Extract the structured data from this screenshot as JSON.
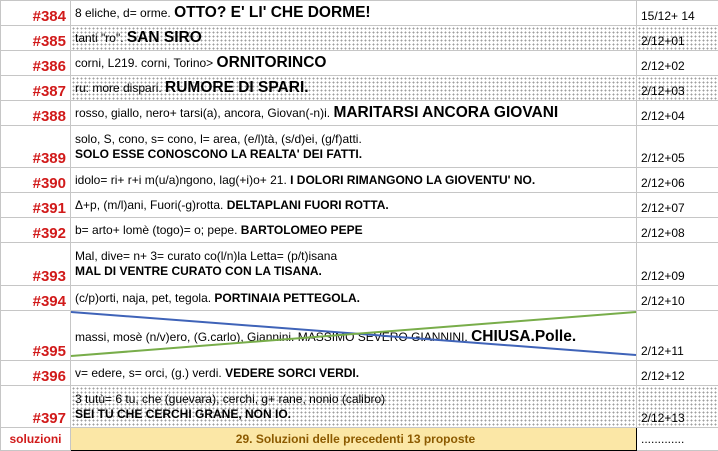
{
  "rows": [
    {
      "num": "#384",
      "parts": [
        {
          "t": "8 eliche, d= orme. "
        },
        {
          "t": "OTTO? E' LI' CHE DORME!",
          "c": "big"
        }
      ],
      "date": "15/12+ 14"
    },
    {
      "num": "#385",
      "parts": [
        {
          "t": "tanti \"ro\". "
        },
        {
          "t": "SAN SIRO",
          "c": "big"
        }
      ],
      "date": "2/12+01"
    },
    {
      "num": "#386",
      "parts": [
        {
          "t": "corni, L219. corni, Torino> "
        },
        {
          "t": "ORNITORINCO",
          "c": "big"
        }
      ],
      "date": "2/12+02"
    },
    {
      "num": "#387",
      "parts": [
        {
          "t": "ru: more dispari. "
        },
        {
          "t": "RUMORE DI SPARI.",
          "c": "big"
        }
      ],
      "date": "2/12+03"
    },
    {
      "num": "#388",
      "parts": [
        {
          "t": "rosso, giallo, nero+ tarsi(a), ancora, Giovan(-n)i. "
        },
        {
          "t": "MARITARSI ANCORA GIOVANI",
          "c": "big"
        }
      ],
      "date": "2/12+04"
    },
    {
      "num": "#389",
      "line1": "solo, S, cono, s= cono, l= area, (e/l)tà, (s/d)ei, (g/f)atti.",
      "line2": "SOLO ESSE CONOSCONO LA REALTA' DEI FATTI.",
      "date": "2/12+05"
    },
    {
      "num": "#390",
      "parts": [
        {
          "t": "idolo= ri+ r+i m(u/a)ngono, lag(+i)o+ 21. "
        },
        {
          "t": "I DOLORI RIMANGONO LA GIOVENTU' NO.",
          "c": "ans"
        }
      ],
      "date": "2/12+06"
    },
    {
      "num": "#391",
      "parts": [
        {
          "t": "Δ+p, (m/l)ani, Fuori(-g)rotta. "
        },
        {
          "t": "DELTAPLANI FUORI ROTTA.",
          "c": "ans"
        }
      ],
      "date": "2/12+07"
    },
    {
      "num": "#392",
      "parts": [
        {
          "t": "b= arto+ lomè (togo)= o; pepe. "
        },
        {
          "t": "BARTOLOMEO PEPE",
          "c": "ans"
        }
      ],
      "date": "2/12+08"
    },
    {
      "num": "#393",
      "line1": "Mal, dive= n+ 3= curato co(l/n)la Letta= (p/t)isana",
      "line2": "MAL DI VENTRE CURATO CON LA TISANA.",
      "date": "2/12+09"
    },
    {
      "num": "#394",
      "parts": [
        {
          "t": "(c/p)orti, naja, pet, tegola. "
        },
        {
          "t": "PORTINAIA PETTEGOLA.",
          "c": "ans"
        }
      ],
      "date": "2/12+10"
    },
    {
      "num": "#395",
      "parts": [
        {
          "t": "massi, mosè (n/v)ero, (G.carlo), Giannini. MASSIMO SEVERO GIANNINI. "
        },
        {
          "t": "CHIUSA.Polle.",
          "c": "big"
        }
      ],
      "date": "2/12+11"
    },
    {
      "num": "#396",
      "parts": [
        {
          "t": "v= edere, s= orci, (g.) verdi. "
        },
        {
          "t": "VEDERE SORCI VERDI.",
          "c": "ans"
        }
      ],
      "date": "2/12+12"
    },
    {
      "num": "#397",
      "line1": "3 tutù= 6 tu, che (guevara), cerchi, g+ rane, nonio (calibro)",
      "line2": "SEI TU CHE CERCHI GRANE, NON IO.",
      "date": "2/12+13"
    }
  ],
  "footer": {
    "label": "soluzioni",
    "text": "29. Soluzioni delle precedenti 13 proposte",
    "date": "............."
  },
  "colors": {
    "number": "#d11a1a",
    "solution_bg": "#fbe7a6",
    "solution_text": "#8c5a00",
    "line_blue": "#3f63b8",
    "line_green": "#78ad4a"
  }
}
